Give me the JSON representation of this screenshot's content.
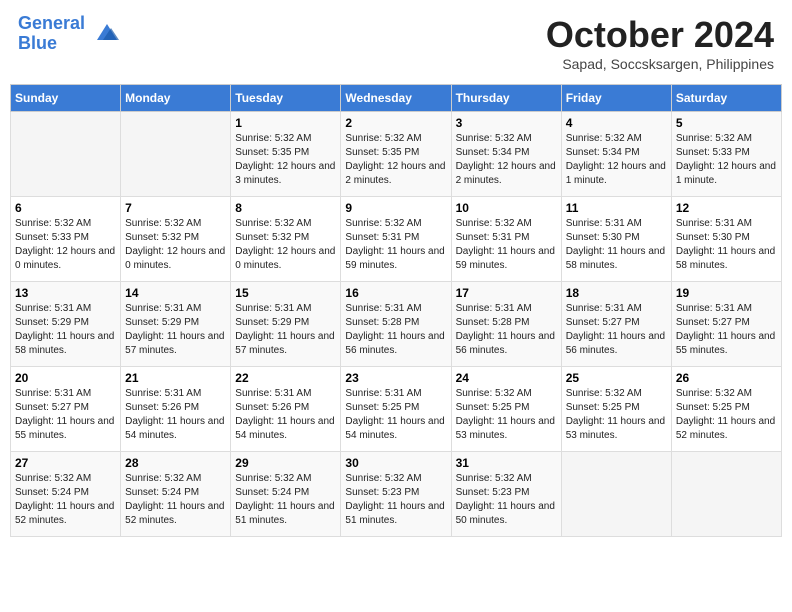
{
  "header": {
    "logo_line1": "General",
    "logo_line2": "Blue",
    "month": "October 2024",
    "location": "Sapad, Soccsksargen, Philippines"
  },
  "weekdays": [
    "Sunday",
    "Monday",
    "Tuesday",
    "Wednesday",
    "Thursday",
    "Friday",
    "Saturday"
  ],
  "weeks": [
    [
      {
        "day": "",
        "info": ""
      },
      {
        "day": "",
        "info": ""
      },
      {
        "day": "1",
        "info": "Sunrise: 5:32 AM\nSunset: 5:35 PM\nDaylight: 12 hours and 3 minutes."
      },
      {
        "day": "2",
        "info": "Sunrise: 5:32 AM\nSunset: 5:35 PM\nDaylight: 12 hours and 2 minutes."
      },
      {
        "day": "3",
        "info": "Sunrise: 5:32 AM\nSunset: 5:34 PM\nDaylight: 12 hours and 2 minutes."
      },
      {
        "day": "4",
        "info": "Sunrise: 5:32 AM\nSunset: 5:34 PM\nDaylight: 12 hours and 1 minute."
      },
      {
        "day": "5",
        "info": "Sunrise: 5:32 AM\nSunset: 5:33 PM\nDaylight: 12 hours and 1 minute."
      }
    ],
    [
      {
        "day": "6",
        "info": "Sunrise: 5:32 AM\nSunset: 5:33 PM\nDaylight: 12 hours and 0 minutes."
      },
      {
        "day": "7",
        "info": "Sunrise: 5:32 AM\nSunset: 5:32 PM\nDaylight: 12 hours and 0 minutes."
      },
      {
        "day": "8",
        "info": "Sunrise: 5:32 AM\nSunset: 5:32 PM\nDaylight: 12 hours and 0 minutes."
      },
      {
        "day": "9",
        "info": "Sunrise: 5:32 AM\nSunset: 5:31 PM\nDaylight: 11 hours and 59 minutes."
      },
      {
        "day": "10",
        "info": "Sunrise: 5:32 AM\nSunset: 5:31 PM\nDaylight: 11 hours and 59 minutes."
      },
      {
        "day": "11",
        "info": "Sunrise: 5:31 AM\nSunset: 5:30 PM\nDaylight: 11 hours and 58 minutes."
      },
      {
        "day": "12",
        "info": "Sunrise: 5:31 AM\nSunset: 5:30 PM\nDaylight: 11 hours and 58 minutes."
      }
    ],
    [
      {
        "day": "13",
        "info": "Sunrise: 5:31 AM\nSunset: 5:29 PM\nDaylight: 11 hours and 58 minutes."
      },
      {
        "day": "14",
        "info": "Sunrise: 5:31 AM\nSunset: 5:29 PM\nDaylight: 11 hours and 57 minutes."
      },
      {
        "day": "15",
        "info": "Sunrise: 5:31 AM\nSunset: 5:29 PM\nDaylight: 11 hours and 57 minutes."
      },
      {
        "day": "16",
        "info": "Sunrise: 5:31 AM\nSunset: 5:28 PM\nDaylight: 11 hours and 56 minutes."
      },
      {
        "day": "17",
        "info": "Sunrise: 5:31 AM\nSunset: 5:28 PM\nDaylight: 11 hours and 56 minutes."
      },
      {
        "day": "18",
        "info": "Sunrise: 5:31 AM\nSunset: 5:27 PM\nDaylight: 11 hours and 56 minutes."
      },
      {
        "day": "19",
        "info": "Sunrise: 5:31 AM\nSunset: 5:27 PM\nDaylight: 11 hours and 55 minutes."
      }
    ],
    [
      {
        "day": "20",
        "info": "Sunrise: 5:31 AM\nSunset: 5:27 PM\nDaylight: 11 hours and 55 minutes."
      },
      {
        "day": "21",
        "info": "Sunrise: 5:31 AM\nSunset: 5:26 PM\nDaylight: 11 hours and 54 minutes."
      },
      {
        "day": "22",
        "info": "Sunrise: 5:31 AM\nSunset: 5:26 PM\nDaylight: 11 hours and 54 minutes."
      },
      {
        "day": "23",
        "info": "Sunrise: 5:31 AM\nSunset: 5:25 PM\nDaylight: 11 hours and 54 minutes."
      },
      {
        "day": "24",
        "info": "Sunrise: 5:32 AM\nSunset: 5:25 PM\nDaylight: 11 hours and 53 minutes."
      },
      {
        "day": "25",
        "info": "Sunrise: 5:32 AM\nSunset: 5:25 PM\nDaylight: 11 hours and 53 minutes."
      },
      {
        "day": "26",
        "info": "Sunrise: 5:32 AM\nSunset: 5:25 PM\nDaylight: 11 hours and 52 minutes."
      }
    ],
    [
      {
        "day": "27",
        "info": "Sunrise: 5:32 AM\nSunset: 5:24 PM\nDaylight: 11 hours and 52 minutes."
      },
      {
        "day": "28",
        "info": "Sunrise: 5:32 AM\nSunset: 5:24 PM\nDaylight: 11 hours and 52 minutes."
      },
      {
        "day": "29",
        "info": "Sunrise: 5:32 AM\nSunset: 5:24 PM\nDaylight: 11 hours and 51 minutes."
      },
      {
        "day": "30",
        "info": "Sunrise: 5:32 AM\nSunset: 5:23 PM\nDaylight: 11 hours and 51 minutes."
      },
      {
        "day": "31",
        "info": "Sunrise: 5:32 AM\nSunset: 5:23 PM\nDaylight: 11 hours and 50 minutes."
      },
      {
        "day": "",
        "info": ""
      },
      {
        "day": "",
        "info": ""
      }
    ]
  ]
}
